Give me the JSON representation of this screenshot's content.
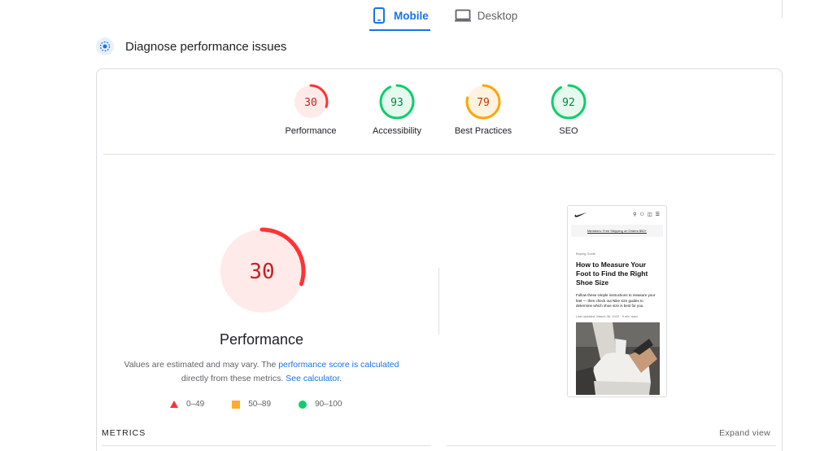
{
  "tabs": {
    "mobile": "Mobile",
    "desktop": "Desktop"
  },
  "section": {
    "title": "Diagnose performance issues"
  },
  "scores": [
    {
      "key": "performance",
      "label": "Performance",
      "value": 30,
      "color": "#ff3333",
      "bg": "#ffeaea"
    },
    {
      "key": "accessibility",
      "label": "Accessibility",
      "value": 93,
      "color": "#0cce6b",
      "bg": "#e6f9ee"
    },
    {
      "key": "best_practices",
      "label": "Best Practices",
      "value": 79,
      "color": "#ffa400",
      "bg": "#fff3e0"
    },
    {
      "key": "seo",
      "label": "SEO",
      "value": 92,
      "color": "#0cce6b",
      "bg": "#e6f9ee"
    }
  ],
  "main": {
    "score": 30,
    "title": "Performance",
    "note_part1": "Values are estimated and may vary. The ",
    "note_link1": "performance score is calculated",
    "note_part2": "directly from these metrics. ",
    "note_link2": "See calculator."
  },
  "legend": {
    "fail": "0–49",
    "average": "50–89",
    "pass": "90–100"
  },
  "thumbnail": {
    "banner": "Members: Free Shipping on Orders $50+",
    "category": "Buying Guide",
    "heading": "How to Measure Your Foot to Find the Right Shoe Size",
    "body": "Follow these simple instructions to measure your feet — then check out Nike size guides to determine which shoe size is best for you.",
    "date": "Last updated: March 08, 2023  ·  9 min read"
  },
  "metrics": {
    "label": "METRICS",
    "expand": "Expand view"
  },
  "colors": {
    "accent": "#1a73e8",
    "fail": "#ff3333",
    "average": "#ffa400",
    "pass": "#0cce6b"
  }
}
